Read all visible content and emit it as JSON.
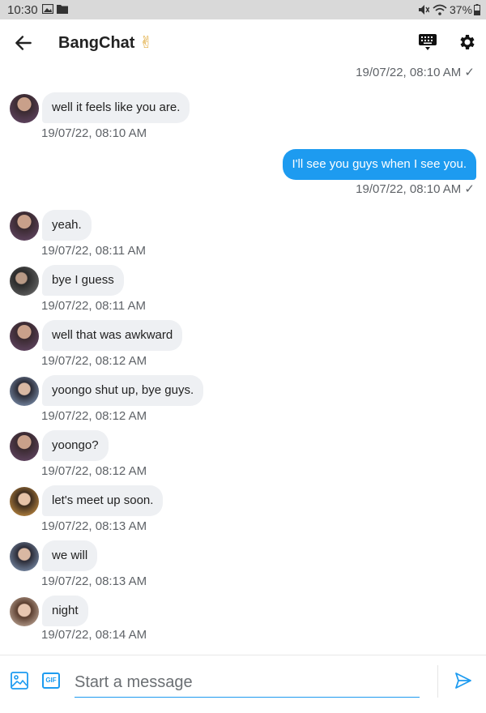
{
  "status_bar": {
    "time": "10:30",
    "battery": "37%"
  },
  "header": {
    "title": "BangChat",
    "title_emoji": "✌"
  },
  "messages": [
    {
      "direction": "out",
      "text": "",
      "timestamp": "19/07/22, 08:10 AM ✓"
    },
    {
      "direction": "in",
      "avatar": "avatar-a",
      "text": "well it feels like you are.",
      "timestamp": "19/07/22, 08:10 AM"
    },
    {
      "direction": "out",
      "text": "I'll see you guys when I see you.",
      "timestamp": "19/07/22, 08:10 AM ✓"
    },
    {
      "direction": "in",
      "avatar": "avatar-a",
      "text": "yeah.",
      "timestamp": "19/07/22, 08:11 AM"
    },
    {
      "direction": "in",
      "avatar": "avatar-b",
      "text": "bye I guess",
      "timestamp": "19/07/22, 08:11 AM"
    },
    {
      "direction": "in",
      "avatar": "avatar-a",
      "text": "well that was awkward",
      "timestamp": "19/07/22, 08:12 AM"
    },
    {
      "direction": "in",
      "avatar": "avatar-c",
      "text": "yoongo shut up, bye guys.",
      "timestamp": "19/07/22, 08:12 AM"
    },
    {
      "direction": "in",
      "avatar": "avatar-a",
      "text": "yoongo?",
      "timestamp": "19/07/22, 08:12 AM"
    },
    {
      "direction": "in",
      "avatar": "avatar-d",
      "text": "let's meet up soon.",
      "timestamp": "19/07/22, 08:13 AM"
    },
    {
      "direction": "in",
      "avatar": "avatar-c",
      "text": "we will",
      "timestamp": "19/07/22, 08:13 AM"
    },
    {
      "direction": "in",
      "avatar": "avatar-e",
      "text": "night",
      "timestamp": "19/07/22, 08:14 AM"
    }
  ],
  "composer": {
    "placeholder": "Start a message",
    "gif_label": "GIF"
  },
  "colors": {
    "accent": "#1d9bf0",
    "incoming_bubble": "#eef0f3",
    "status_bar": "#d9d9d9"
  }
}
